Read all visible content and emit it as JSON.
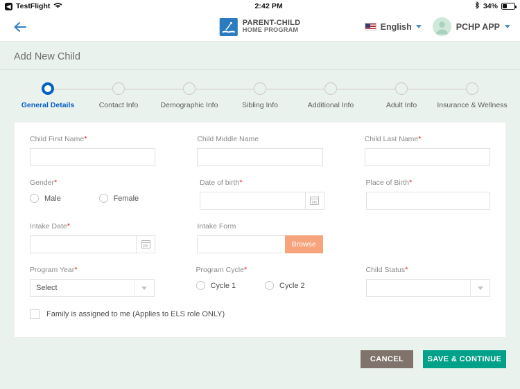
{
  "statusbar": {
    "carrier": "TestFlight",
    "time": "2:42 PM",
    "battery_percent": "34%",
    "wifi_icon": "wifi-icon",
    "bluetooth_icon": "bluetooth-icon",
    "battery_icon": "battery-icon"
  },
  "topnav": {
    "back_icon": "back-arrow-icon",
    "brand_line1": "PARENT-CHILD",
    "brand_line2": "HOME PROGRAM",
    "language": "English",
    "user": "PCHP APP",
    "flag_icon": "us-flag-icon",
    "chevron_icon": "chevron-down-icon",
    "avatar_icon": "user-avatar-icon"
  },
  "page": {
    "title": "Add New Child"
  },
  "stepper": {
    "steps": [
      {
        "label": "General Details",
        "active": true
      },
      {
        "label": "Contact Info",
        "active": false
      },
      {
        "label": "Demographic Info",
        "active": false
      },
      {
        "label": "Sibling Info",
        "active": false
      },
      {
        "label": "Additional Info",
        "active": false
      },
      {
        "label": "Adult Info",
        "active": false
      },
      {
        "label": "Insurance & Wellness",
        "active": false
      }
    ]
  },
  "form": {
    "child_first_name": {
      "label": "Child First Name",
      "required": true,
      "value": ""
    },
    "child_middle_name": {
      "label": "Child Middle Name",
      "required": false,
      "value": ""
    },
    "child_last_name": {
      "label": "Child Last Name",
      "required": true,
      "value": ""
    },
    "gender": {
      "label": "Gender",
      "required": true,
      "options": [
        "Male",
        "Female"
      ],
      "selected": ""
    },
    "date_of_birth": {
      "label": "Date of birth",
      "required": true,
      "value": "",
      "icon": "calendar-icon"
    },
    "place_of_birth": {
      "label": "Place of Birth",
      "required": true,
      "value": ""
    },
    "intake_date": {
      "label": "Intake Date",
      "required": true,
      "value": "",
      "icon": "calendar-icon"
    },
    "intake_form": {
      "label": "Intake Form",
      "required": false,
      "value": "",
      "browse_label": "Browse"
    },
    "program_year": {
      "label": "Program Year",
      "required": true,
      "value": "Select"
    },
    "program_cycle": {
      "label": "Program Cycle",
      "required": true,
      "options": [
        "Cycle 1",
        "Cycle 2"
      ],
      "selected": ""
    },
    "child_status": {
      "label": "Child Status",
      "required": true,
      "value": ""
    },
    "family_assigned": {
      "label": "Family is assigned to me (Applies to ELS role ONLY)",
      "checked": false
    }
  },
  "actions": {
    "cancel": "CANCEL",
    "save": "SAVE & CONTINUE"
  },
  "colors": {
    "accent_blue": "#0a5fc4",
    "teal": "#00a189",
    "cancel_gray": "#7f736b",
    "browse_orange": "#f7a47c",
    "required_red": "#e02b2b",
    "page_bg": "#e9f2ec"
  }
}
